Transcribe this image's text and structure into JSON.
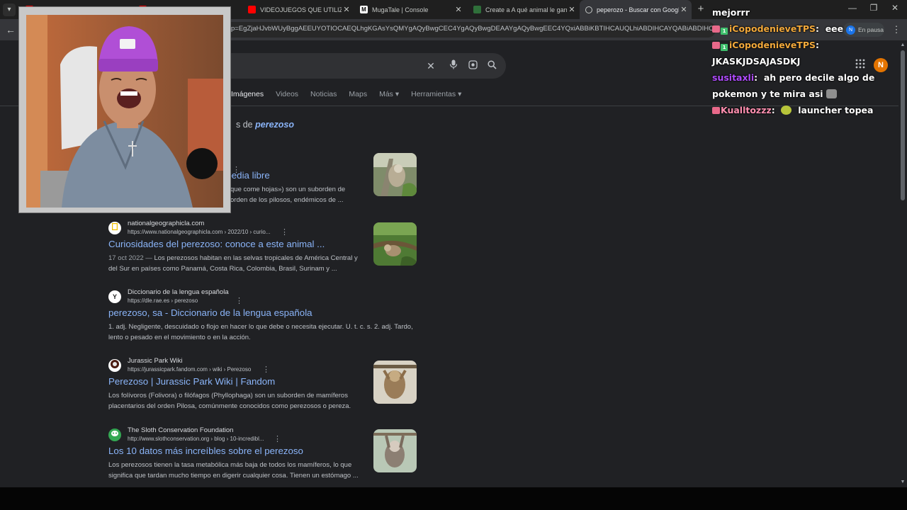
{
  "tabs": [
    {
      "title": "",
      "favicon": "youtube-icon",
      "active": false
    },
    {
      "title": "",
      "favicon": "youtube-icon",
      "active": false
    },
    {
      "title": "VIDEOJUEGOS QUE UTILIZARON",
      "favicon": "youtube-icon",
      "active": false
    },
    {
      "title": "MugaTale | Console",
      "favicon": "mugatale-icon",
      "active": false
    },
    {
      "title": "Create a A qué animal le ganar",
      "favicon": "app-icon",
      "active": false
    },
    {
      "title": "peperozo - Buscar con Google",
      "favicon": "google-icon",
      "active": true
    }
  ],
  "toolbar": {
    "url": "p=EgZjaHJvbWUyBggAEEUYOTIOCAEQLhgKGAsYsQMYgAQyBwgCEC4YgAQyBwgDEAAYgAQyBwgEEC4YQxiABBiKBTIHCAUQLhiABDIHCAYQABiABDIHCAcQLhiABDI",
    "profile_status": "En pausa",
    "profile_initial": "N"
  },
  "search": {
    "account_initial": "N",
    "filters": [
      "Imágenes",
      "Videos",
      "Noticias",
      "Maps",
      "Más ▾",
      "Herramientas ▾"
    ],
    "did_you_mean_prefix": "s de",
    "did_you_mean_term": "perezoso"
  },
  "results": [
    {
      "site": "",
      "url": "",
      "title": "opedia libre",
      "date": "",
      "snippet": "que come hojas») son un suborden de\norden de los pilosos, endémicos de ...",
      "has_thumb": true
    },
    {
      "site": "nationalgeographicla.com",
      "url": "https://www.nationalgeographicla.com › 2022/10 › curio...",
      "title": "Curiosidades del perezoso: conoce a este animal ...",
      "date": "17 oct 2022 — ",
      "snippet": "Los perezosos habitan en las selvas tropicales de América Central y del Sur en países como Panamá, Costa Rica, Colombia, Brasil, Surinam y ...",
      "has_thumb": true
    },
    {
      "site": "Diccionario de la lengua española",
      "url": "https://dle.rae.es › perezoso",
      "title": "perezoso, sa - Diccionario de la lengua española",
      "date": "",
      "snippet": "1. adj. Negligente, descuidado o flojo en hacer lo que debe o necesita ejecutar. U. t. c. s. 2. adj. Tardo, lento o pesado en el movimiento o en la acción.",
      "has_thumb": false
    },
    {
      "site": "Jurassic Park Wiki",
      "url": "https://jurassicpark.fandom.com › wiki › Perezoso",
      "title": "Perezoso | Jurassic Park Wiki | Fandom",
      "date": "",
      "snippet": "Los folívoros (Folivora) o filófagos (Phyllophaga) son un suborden de mamíferos placentarios del orden Pilosa, comúnmente conocidos como perezosos o pereza.",
      "has_thumb": true
    },
    {
      "site": "The Sloth Conservation Foundation",
      "url": "http://www.slothconservation.org › blog › 10-incredibl...",
      "title": "Los 10 datos más increíbles sobre el perezoso",
      "date": "",
      "snippet": "Los perezosos tienen la tasa metabólica más baja de todos los mamíferos, lo que significa que tardan mucho tiempo en digerir cualquier cosa. Tienen un estómago ...",
      "has_thumb": true
    }
  ],
  "chat": [
    {
      "user": "",
      "text": "mejorrr",
      "color": "#ffffff"
    },
    {
      "user": "iCopodenieveTPS",
      "text": "eee",
      "color": "#f2a93b"
    },
    {
      "user": "iCopodenieveTPS",
      "text": "JKASKJDSAJASDKJ",
      "color": "#f2a93b"
    },
    {
      "user": "susitaxli",
      "text": "ah pero decile algo de",
      "text2": "pokemon y te mira asi",
      "color": "#b04cff"
    },
    {
      "user": "Kualltozzz",
      "text": "launcher topea",
      "color": "#ff8fb0"
    }
  ],
  "colors": {
    "background": "#202124",
    "link": "#8ab4f8",
    "snippet": "#bdc1c6",
    "account": "#e37400"
  }
}
